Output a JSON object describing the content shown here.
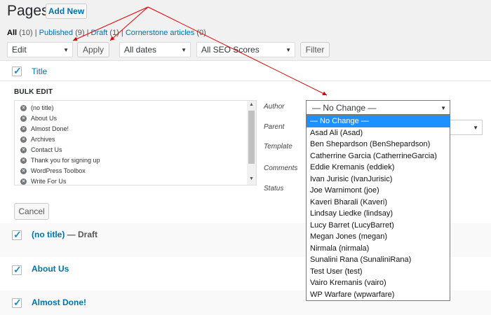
{
  "header": {
    "title": "Pages",
    "add_new": "Add New"
  },
  "filters": {
    "all": "All",
    "all_count": "(10)",
    "published": "Published",
    "published_count": "(9)",
    "draft": "Draft",
    "draft_count": "(1)",
    "cornerstone": "Cornerstone articles",
    "cornerstone_count": "(0)",
    "sep": "|"
  },
  "toolbar": {
    "bulk_action": "Edit",
    "apply": "Apply",
    "dates": "All dates",
    "seo": "All SEO Scores",
    "filter": "Filter"
  },
  "table": {
    "title_column": "Title"
  },
  "bulk_edit": {
    "heading": "BULK EDIT",
    "items": [
      "(no title)",
      "About Us",
      "Almost Done!",
      "Archives",
      "Contact Us",
      "Thank you for signing up",
      "WordPress Toolbox",
      "Write For Us"
    ],
    "labels": {
      "author": "Author",
      "parent": "Parent",
      "template": "Template",
      "comments": "Comments",
      "status": "Status"
    },
    "author_value": "— No Change —",
    "cancel": "Cancel"
  },
  "author_options": [
    "— No Change —",
    "Asad Ali (Asad)",
    "Ben Shepardson (BenShepardson)",
    "Catherrine Garcia (CatherrineGarcia)",
    "Eddie Kremanis (eddiek)",
    "Ivan Jurisic (IvanJurisic)",
    "Joe Warnimont (joe)",
    "Kaveri Bharali (Kaveri)",
    "Lindsay Liedke (lindsay)",
    "Lucy Barret (LucyBarret)",
    "Megan Jones (megan)",
    "Nirmala (nirmala)",
    "Sunalini Rana (SunaliniRana)",
    "Test User (test)",
    "Vairo Kremanis (vairo)",
    "WP Warfare (wpwarfare)"
  ],
  "rows": [
    {
      "title": "(no title)",
      "state": " — Draft"
    },
    {
      "title": "About Us",
      "state": ""
    },
    {
      "title": "Almost Done!",
      "state": ""
    }
  ],
  "colors": {
    "link": "#0073aa",
    "annotation": "#e00000",
    "highlight": "#1e90ff"
  }
}
